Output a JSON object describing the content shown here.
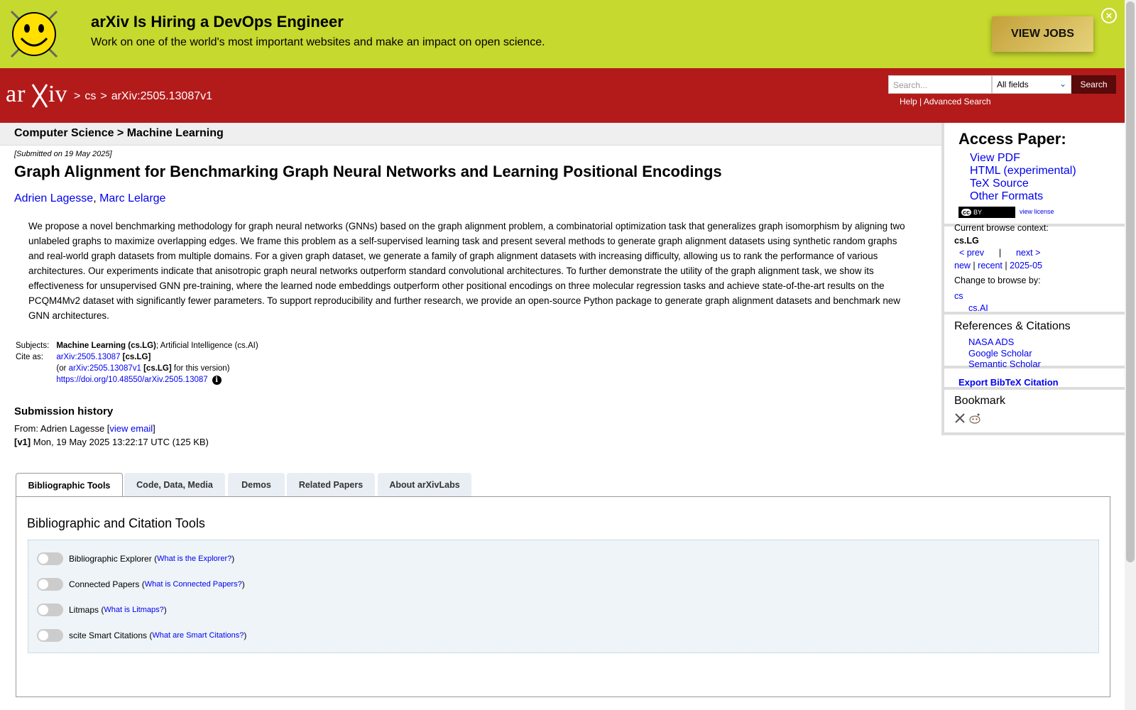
{
  "banner": {
    "title": "arXiv Is Hiring a DevOps Engineer",
    "subtitle": "Work on one of the world's most important websites and make an impact on open science.",
    "button": "VIEW JOBS",
    "close_icon": "close-circle-icon"
  },
  "header": {
    "logo_text": "arXiv",
    "breadcrumb": [
      ">",
      "cs",
      ">",
      "arXiv:2505.13087v1"
    ],
    "search_placeholder": "Search...",
    "search_field": "All fields",
    "search_button": "Search",
    "help": "Help",
    "separator": "|",
    "advanced": "Advanced Search"
  },
  "subject_bar": "Computer Science > Machine Learning",
  "paper": {
    "submitted": "[Submitted on 19 May 2025]",
    "title": "Graph Alignment for Benchmarking Graph Neural Networks and Learning Positional Encodings",
    "authors": [
      "Adrien Lagesse",
      "Marc Lelarge"
    ],
    "author_sep": ", ",
    "abstract": "We propose a novel benchmarking methodology for graph neural networks (GNNs) based on the graph alignment problem, a combinatorial optimization task that generalizes graph isomorphism by aligning two unlabeled graphs to maximize overlapping edges. We frame this problem as a self-supervised learning task and present several methods to generate graph alignment datasets using synthetic random graphs and real-world graph datasets from multiple domains. For a given graph dataset, we generate a family of graph alignment datasets with increasing difficulty, allowing us to rank the performance of various architectures. Our experiments indicate that anisotropic graph neural networks outperform standard convolutional architectures. To further demonstrate the utility of the graph alignment task, we show its effectiveness for unsupervised GNN pre-training, where the learned node embeddings outperform other positional encodings on three molecular regression tasks and achieve state-of-the-art results on the PCQM4Mv2 dataset with significantly fewer parameters. To support reproducibility and further research, we provide an open-source Python package to generate graph alignment datasets and benchmark new GNN architectures.",
    "subjects_label": "Subjects:",
    "subjects_primary": "Machine Learning (cs.LG)",
    "subjects_rest": "; Artificial Intelligence (cs.AI)",
    "cite_label": "Cite as:",
    "cite_id": "arXiv:2505.13087",
    "cite_cat": "[cs.LG]",
    "cite_or": "(or",
    "cite_v1": "arXiv:2505.13087v1",
    "cite_v1_cat": "[cs.LG]",
    "cite_v1_suffix": "for this version)",
    "doi": "https://doi.org/10.48550/arXiv.2505.13087",
    "info_icon": "info-icon"
  },
  "history": {
    "title": "Submission history",
    "from_prefix": "From: Adrien Lagesse [",
    "view_email": "view email",
    "from_suffix": "]",
    "v1_label": "[v1]",
    "v1_text": " Mon, 19 May 2025 13:22:17 UTC (125 KB)"
  },
  "sidebar": {
    "access_title": "Access Paper:",
    "access_links": [
      "View PDF",
      "HTML (experimental)",
      "TeX Source",
      "Other Formats"
    ],
    "license_badge": "BY",
    "view_license": "view license",
    "context_label": "Current browse context:",
    "context_value": "cs.LG",
    "prev": "< prev",
    "pipe": "|",
    "next": "next >",
    "new": "new",
    "recent": "recent",
    "month": "2025-05",
    "change_label": "Change to browse by:",
    "browse_cs": "cs",
    "browse_csai": "cs.AI",
    "refs_title": "References & Citations",
    "refs_links": [
      "NASA ADS",
      "Google Scholar",
      "Semantic Scholar"
    ],
    "bibtex": "Export BibTeX Citation",
    "bookmark_title": "Bookmark"
  },
  "tabs": [
    "Bibliographic Tools",
    "Code, Data, Media",
    "Demos",
    "Related Papers",
    "About arXivLabs"
  ],
  "panel": {
    "title": "Bibliographic and Citation Tools",
    "tools": [
      {
        "label": "Bibliographic Explorer",
        "link": "What is the Explorer?"
      },
      {
        "label": "Connected Papers",
        "link": "What is Connected Papers?"
      },
      {
        "label": "Litmaps",
        "link": "What is Litmaps?"
      },
      {
        "label": "scite Smart Citations",
        "link": "What are Smart Citations?"
      }
    ]
  }
}
